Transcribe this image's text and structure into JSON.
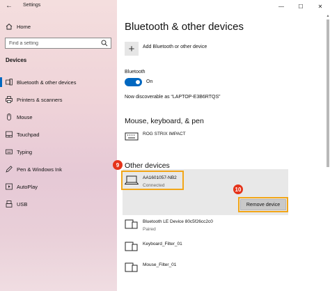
{
  "window": {
    "title": "Settings",
    "minimize_glyph": "—",
    "maximize_glyph": "☐",
    "close_glyph": "✕"
  },
  "sidebar": {
    "home_label": "Home",
    "search_placeholder": "Find a setting",
    "section_title": "Devices",
    "items": [
      {
        "label": "Bluetooth & other devices",
        "icon": "bluetooth-devices-icon",
        "active": true
      },
      {
        "label": "Printers & scanners",
        "icon": "printer-icon"
      },
      {
        "label": "Mouse",
        "icon": "mouse-icon"
      },
      {
        "label": "Touchpad",
        "icon": "touchpad-icon"
      },
      {
        "label": "Typing",
        "icon": "keyboard-icon"
      },
      {
        "label": "Pen & Windows Ink",
        "icon": "pen-icon"
      },
      {
        "label": "AutoPlay",
        "icon": "autoplay-icon"
      },
      {
        "label": "USB",
        "icon": "usb-icon"
      }
    ]
  },
  "main": {
    "title": "Bluetooth & other devices",
    "add_device_label": "Add Bluetooth or other device",
    "bluetooth_label": "Bluetooth",
    "bluetooth_state": "On",
    "discoverable_text": "Now discoverable as “LAPTOP-E3B6RTQS”",
    "mouse_section": {
      "title": "Mouse, keyboard, & pen",
      "devices": [
        {
          "name": "ROG STRIX IMPACT",
          "status": ""
        }
      ]
    },
    "other_section": {
      "title": "Other devices",
      "devices": [
        {
          "name": "AA1601057-NB2",
          "status": "Connected",
          "selected": true
        },
        {
          "name": "Bluetooth LE Device 80c5f26cc2c0",
          "status": "Paired"
        },
        {
          "name": "Keyboard_Filter_01",
          "status": ""
        },
        {
          "name": "Mouse_Filter_01",
          "status": ""
        }
      ]
    },
    "remove_button_label": "Remove device"
  },
  "annotations": {
    "step_a": "9",
    "step_b": "10",
    "color": "#e5331a",
    "highlight_color": "#f2a618"
  },
  "colors": {
    "accent": "#0067c0"
  }
}
